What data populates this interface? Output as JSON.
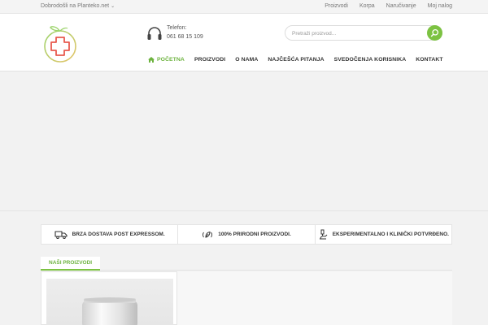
{
  "topbar": {
    "welcome": "Dobrodošli na Planteko.net",
    "links": [
      "Proizvodi",
      "Korpa",
      "Naručivanje",
      "Moj nalog"
    ]
  },
  "header": {
    "phone_label": "Telefon:",
    "phone_number": "061 68 15 109",
    "search_placeholder": "Pretraži proizvod..."
  },
  "nav": {
    "items": [
      "POČETNA",
      "PROIZVODI",
      "O NAMA",
      "NAJČEŠĆA PITANJA",
      "SVEDOČENJA KORISNIKA",
      "KONTAKT"
    ],
    "active_index": 0
  },
  "features": [
    {
      "icon": "truck-icon",
      "label": "BRZA DOSTAVA POST EXPRESSOM."
    },
    {
      "icon": "leaf-icon",
      "label": "100% PRIRODNI PROIZVODI."
    },
    {
      "icon": "microscope-icon",
      "label": "EKSPERIMENTALNO I KLINIČKI POTVRĐENO."
    }
  ],
  "section": {
    "tab_label": "NAŠI PROIZVODI"
  },
  "colors": {
    "accent": "#7cc242",
    "accent_text": "#6db33f",
    "logo_red": "#e85a4f"
  }
}
